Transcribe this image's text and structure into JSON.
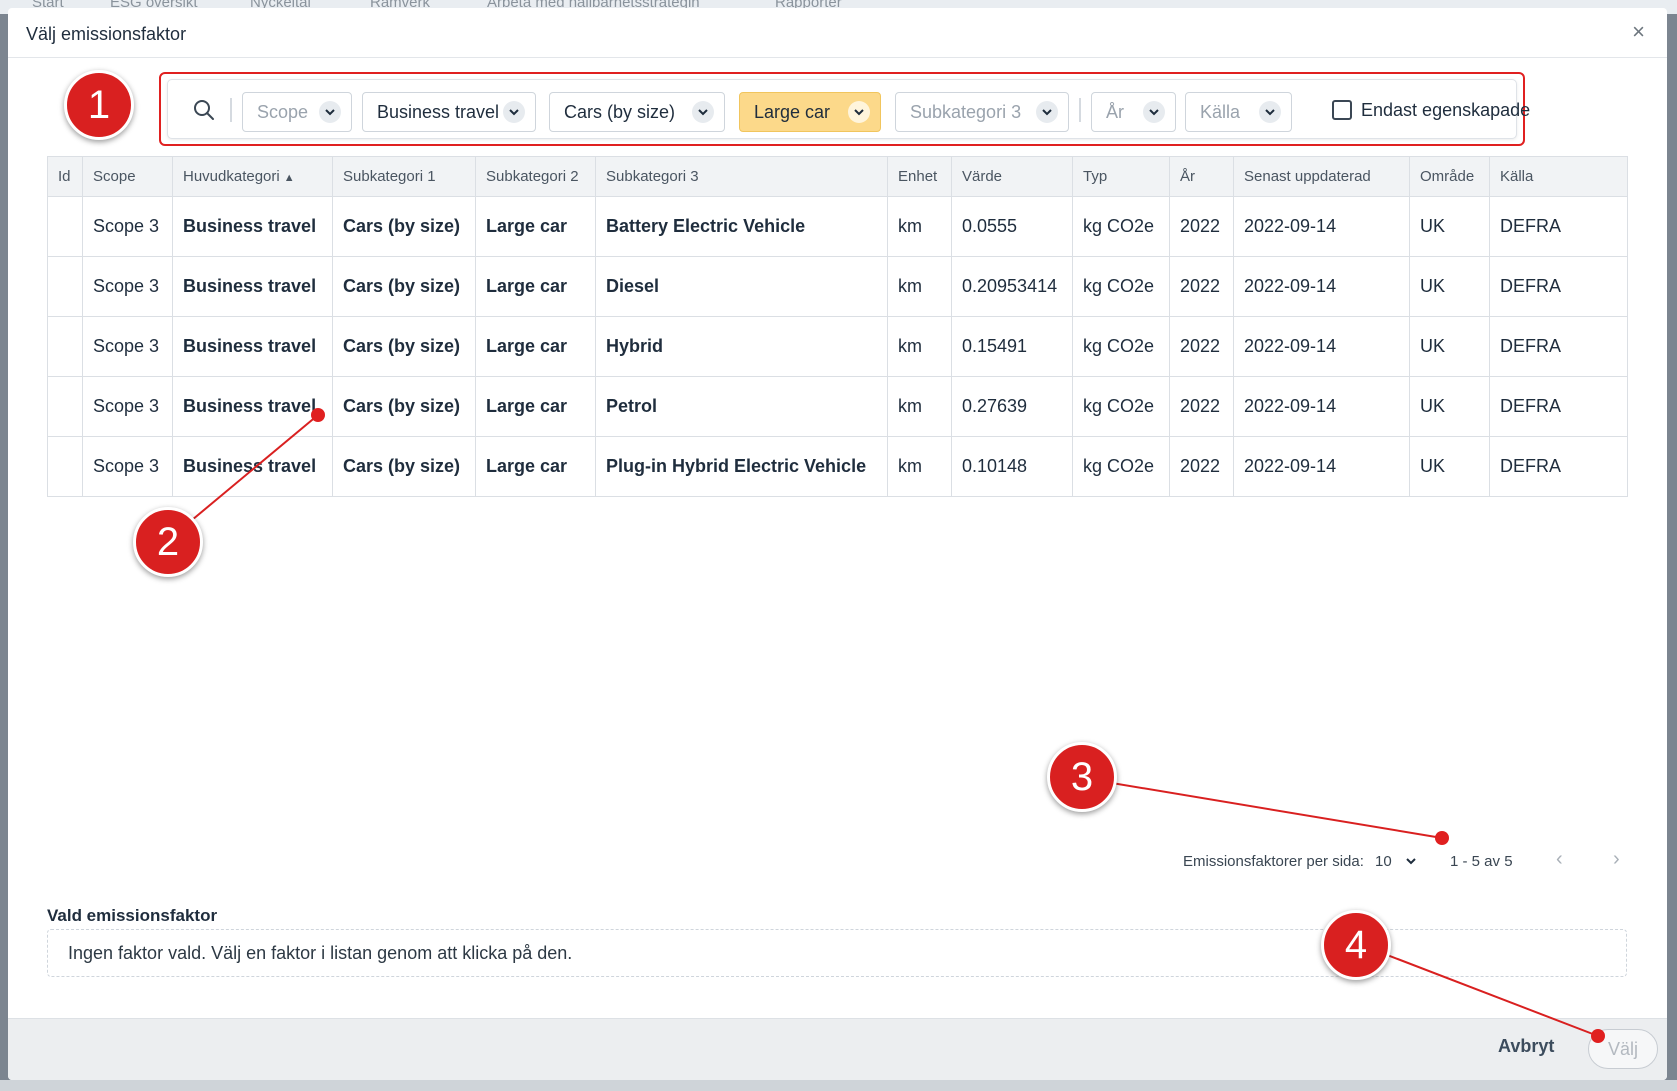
{
  "background": {
    "nav_items": [
      "Start",
      "ESG översikt",
      "Nyckeltal",
      "Ramverk",
      "Arbeta med hållbarhetsstrategin",
      "Rapporter"
    ]
  },
  "modal": {
    "title": "Välj emissionsfaktor",
    "close_label": "×"
  },
  "filters": {
    "scope": "Scope",
    "huvudkategori": "Business travel",
    "subkategori1": "Cars (by size)",
    "subkategori2": "Large car",
    "subkategori3": "Subkategori 3",
    "ar": "År",
    "kalla": "Källa",
    "only_own_label": "Endast egenskapade"
  },
  "table": {
    "headers": [
      "Id",
      "Scope",
      "Huvudkategori",
      "Subkategori 1",
      "Subkategori 2",
      "Subkategori 3",
      "Enhet",
      "Värde",
      "Typ",
      "År",
      "Senast uppdaterad",
      "Område",
      "Källa"
    ],
    "sort_indicator": "▲",
    "rows": [
      [
        "",
        "Scope 3",
        "Business travel",
        "Cars (by size)",
        "Large car",
        "Battery Electric Vehicle",
        "km",
        "0.0555",
        "kg CO2e",
        "2022",
        "2022-09-14",
        "UK",
        "DEFRA"
      ],
      [
        "",
        "Scope 3",
        "Business travel",
        "Cars (by size)",
        "Large car",
        "Diesel",
        "km",
        "0.20953414",
        "kg CO2e",
        "2022",
        "2022-09-14",
        "UK",
        "DEFRA"
      ],
      [
        "",
        "Scope 3",
        "Business travel",
        "Cars (by size)",
        "Large car",
        "Hybrid",
        "km",
        "0.15491",
        "kg CO2e",
        "2022",
        "2022-09-14",
        "UK",
        "DEFRA"
      ],
      [
        "",
        "Scope 3",
        "Business travel",
        "Cars (by size)",
        "Large car",
        "Petrol",
        "km",
        "0.27639",
        "kg CO2e",
        "2022",
        "2022-09-14",
        "UK",
        "DEFRA"
      ],
      [
        "",
        "Scope 3",
        "Business travel",
        "Cars (by size)",
        "Large car",
        "Plug-in Hybrid Electric Vehicle",
        "km",
        "0.10148",
        "kg CO2e",
        "2022",
        "2022-09-14",
        "UK",
        "DEFRA"
      ]
    ]
  },
  "pagination": {
    "per_page_label": "Emissionsfaktorer per sida:",
    "per_page_value": "10",
    "range_label": "1 - 5 av 5",
    "prev": "‹",
    "next": "›"
  },
  "selected": {
    "title": "Vald emissionsfaktor",
    "empty_text": "Ingen faktor vald. Välj en faktor i listan genom att klicka på den."
  },
  "footer": {
    "cancel_label": "Avbryt",
    "choose_label": "Välj"
  },
  "annotations": {
    "markers": [
      "1",
      "2",
      "3",
      "4"
    ],
    "color": "#d92020"
  }
}
